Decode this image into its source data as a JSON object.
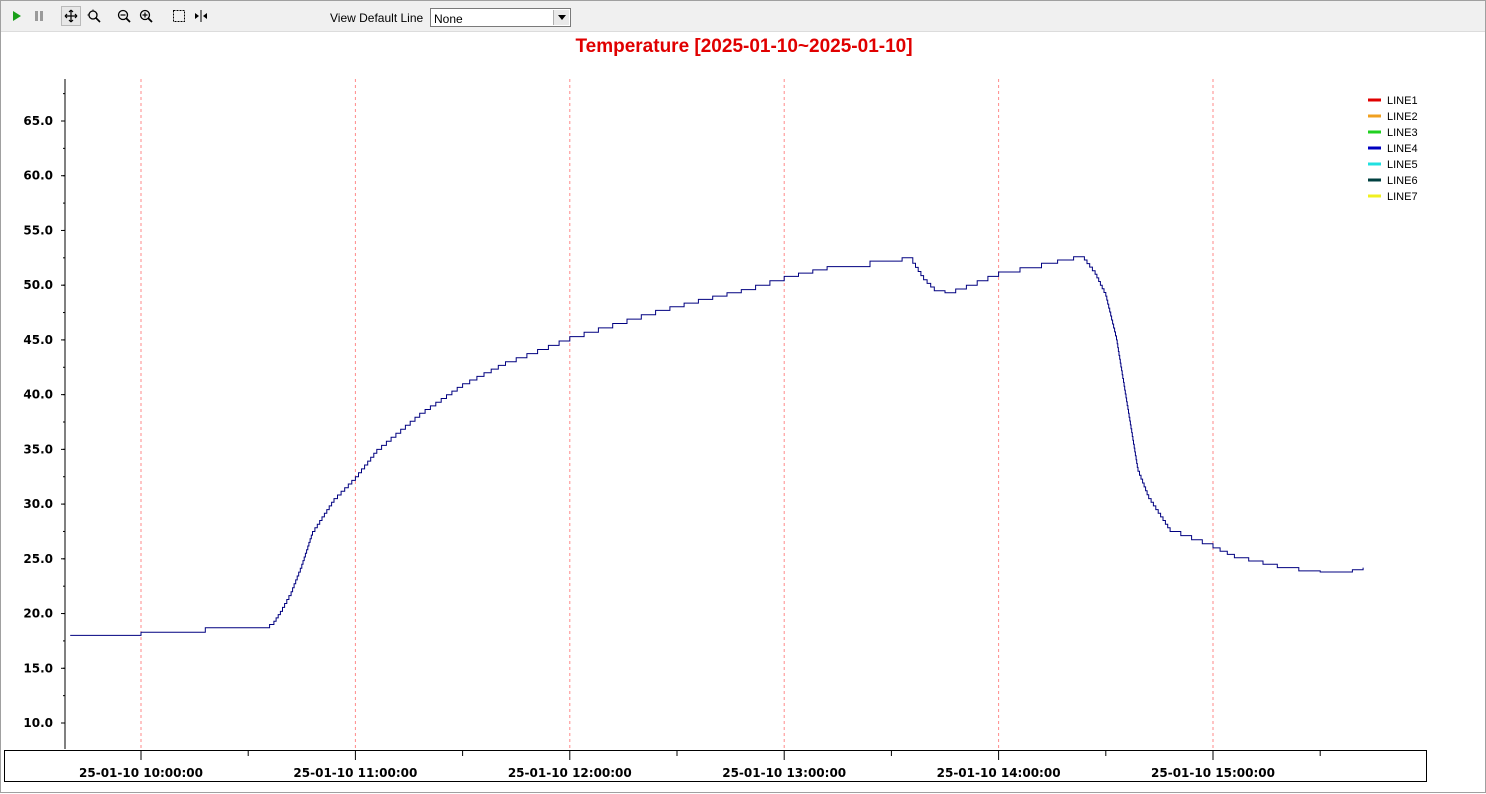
{
  "toolbar": {
    "buttons": [
      {
        "name": "play-icon",
        "tooltip": ""
      },
      {
        "name": "pause-icon",
        "tooltip": ""
      },
      {
        "name": "pan-icon",
        "tooltip": ""
      },
      {
        "name": "zoom-area-icon",
        "tooltip": ""
      },
      {
        "name": "zoom-out-icon",
        "tooltip": ""
      },
      {
        "name": "zoom-in-icon",
        "tooltip": ""
      },
      {
        "name": "select-box-icon",
        "tooltip": ""
      },
      {
        "name": "fit-width-icon",
        "tooltip": ""
      }
    ],
    "default_line_label": "View Default Line",
    "default_line_value": "None"
  },
  "colors": {
    "title": "#e00000",
    "series": "#000080",
    "grid": "#ff8a8a"
  },
  "chart_data": {
    "type": "line",
    "title": "Temperature [2025-01-10~2025-01-10]",
    "xlabel": "",
    "ylabel": "",
    "ylim": [
      7.5,
      69.0
    ],
    "x_unit": "hour of day (2025-01-10)",
    "x_range": [
      9.67,
      15.7
    ],
    "y_ticks": [
      "10.0",
      "15.0",
      "20.0",
      "25.0",
      "30.0",
      "35.0",
      "40.0",
      "45.0",
      "50.0",
      "55.0",
      "60.0",
      "65.0"
    ],
    "x_ticks": [
      {
        "hour": 10,
        "label": "25-01-10 10:00:00"
      },
      {
        "hour": 11,
        "label": "25-01-10 11:00:00"
      },
      {
        "hour": 12,
        "label": "25-01-10 12:00:00"
      },
      {
        "hour": 13,
        "label": "25-01-10 13:00:00"
      },
      {
        "hour": 14,
        "label": "25-01-10 14:00:00"
      },
      {
        "hour": 15,
        "label": "25-01-10 15:00:00"
      }
    ],
    "grid": "vertical dashed at each hour",
    "legend_position": "top-right",
    "legend": [
      {
        "name": "LINE1",
        "color": "#e00000"
      },
      {
        "name": "LINE2",
        "color": "#f0a020"
      },
      {
        "name": "LINE3",
        "color": "#20d020"
      },
      {
        "name": "LINE4",
        "color": "#0000c0"
      },
      {
        "name": "LINE5",
        "color": "#20e0e0"
      },
      {
        "name": "LINE6",
        "color": "#004040"
      },
      {
        "name": "LINE7",
        "color": "#f0f020"
      }
    ],
    "series": [
      {
        "name": "LINE4",
        "step": true,
        "x": [
          9.67,
          10.0,
          10.3,
          10.6,
          10.62,
          10.65,
          10.7,
          10.75,
          10.8,
          10.9,
          11.0,
          11.1,
          11.3,
          11.5,
          11.7,
          11.9,
          12.0,
          12.2,
          12.4,
          12.6,
          12.8,
          13.0,
          13.2,
          13.4,
          13.55,
          13.6,
          13.65,
          13.7,
          13.75,
          13.85,
          14.0,
          14.2,
          14.35,
          14.4,
          14.45,
          14.5,
          14.55,
          14.6,
          14.65,
          14.7,
          14.8,
          15.0,
          15.1,
          15.3,
          15.4,
          15.5,
          15.6,
          15.65,
          15.7
        ],
        "y": [
          18.0,
          18.3,
          18.7,
          19.0,
          19.3,
          20.2,
          22.0,
          24.5,
          27.5,
          30.5,
          32.5,
          35.0,
          38.3,
          41.0,
          43.0,
          44.5,
          45.3,
          46.5,
          47.7,
          48.7,
          49.6,
          50.8,
          51.7,
          52.2,
          52.5,
          52.0,
          50.5,
          49.5,
          49.3,
          50.0,
          51.2,
          52.0,
          52.6,
          52.3,
          51.0,
          49.0,
          45.0,
          39.0,
          33.0,
          30.5,
          27.5,
          26.0,
          25.1,
          24.2,
          23.9,
          23.8,
          23.8,
          24.0,
          24.2
        ]
      }
    ]
  }
}
